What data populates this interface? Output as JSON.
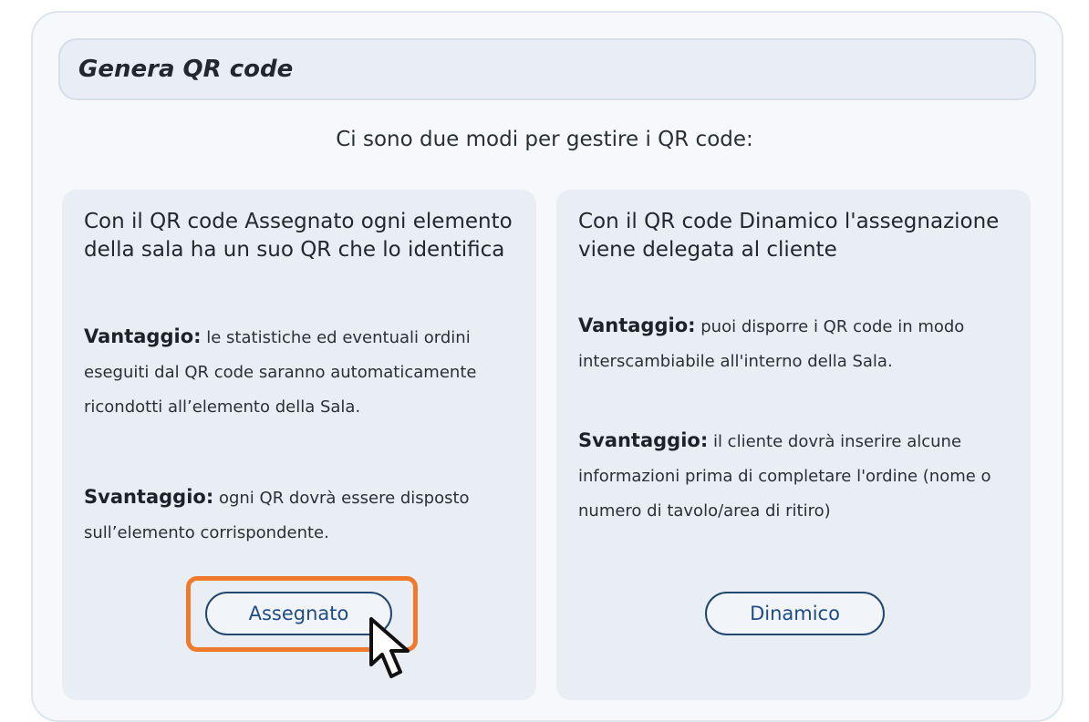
{
  "header": {
    "title": "Genera QR code"
  },
  "intro": "Ci sono due modi per gestire i QR code:",
  "cards": {
    "assegnato": {
      "heading": "Con il QR code Assegnato ogni elemento della sala ha un suo QR che lo identifica",
      "advantage_label": "Vantaggio:",
      "advantage_text": " le statistiche ed eventuali ordini eseguiti dal QR code saranno automaticamente ricondotti all’elemento della Sala.",
      "disadvantage_label": "Svantaggio:",
      "disadvantage_text": " ogni QR dovrà essere disposto sull’elemento corrispondente.",
      "button_label": "Assegnato"
    },
    "dinamico": {
      "heading": "Con il QR code Dinamico l'assegnazione viene delegata al cliente",
      "advantage_label": "Vantaggio:",
      "advantage_text": " puoi disporre i QR code in modo interscambiabile all'interno della Sala.",
      "disadvantage_label": "Svantaggio:",
      "disadvantage_text": " il cliente dovrà inserire alcune informazioni prima di completare l'ordine (nome o numero di tavolo/area di ritiro)",
      "button_label": "Dinamico"
    }
  },
  "colors": {
    "accent_highlight": "#ef7a2c",
    "button_text": "#1f4c84",
    "card_background": "#e9edf4"
  },
  "icons": {
    "cursor": "mouse-pointer-icon"
  }
}
